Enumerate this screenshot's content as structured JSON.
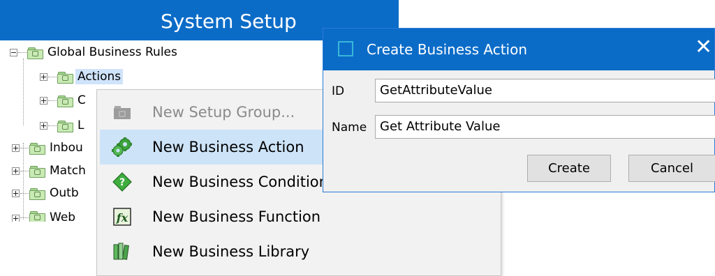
{
  "system_setup": {
    "title": "System Setup"
  },
  "tree": {
    "root": {
      "label": "Global Business Rules",
      "icon": "folder-icon",
      "expanded": true
    },
    "children": [
      {
        "label": "Actions",
        "selected": true
      },
      {
        "label": "C"
      },
      {
        "label": "L"
      }
    ],
    "siblings": [
      {
        "label": "Inbou"
      },
      {
        "label": "Match"
      },
      {
        "label": "Outb"
      },
      {
        "label": "Web"
      }
    ]
  },
  "context_menu": {
    "items": [
      {
        "label": "New Setup Group...",
        "icon": "setup-group-icon",
        "disabled": true
      },
      {
        "label": "New Business Action",
        "icon": "gears-icon",
        "highlighted": true
      },
      {
        "label": "New Business Condition",
        "icon": "condition-diamond-icon"
      },
      {
        "label": "New Business Function",
        "icon": "function-fx-icon"
      },
      {
        "label": "New Business Library",
        "icon": "library-books-icon"
      }
    ]
  },
  "dialog": {
    "title": "Create Business Action",
    "close_glyph": "✕",
    "id_label": "ID",
    "id_value": "GetAttributeValue",
    "name_label": "Name",
    "name_value": "Get Attribute Value",
    "create_label": "Create",
    "cancel_label": "Cancel"
  },
  "colors": {
    "title_bar": "#0b6cc8",
    "selection": "#cfe3fa",
    "menu_hover": "#cde3f8",
    "folder_fill": "#c9eab5"
  }
}
